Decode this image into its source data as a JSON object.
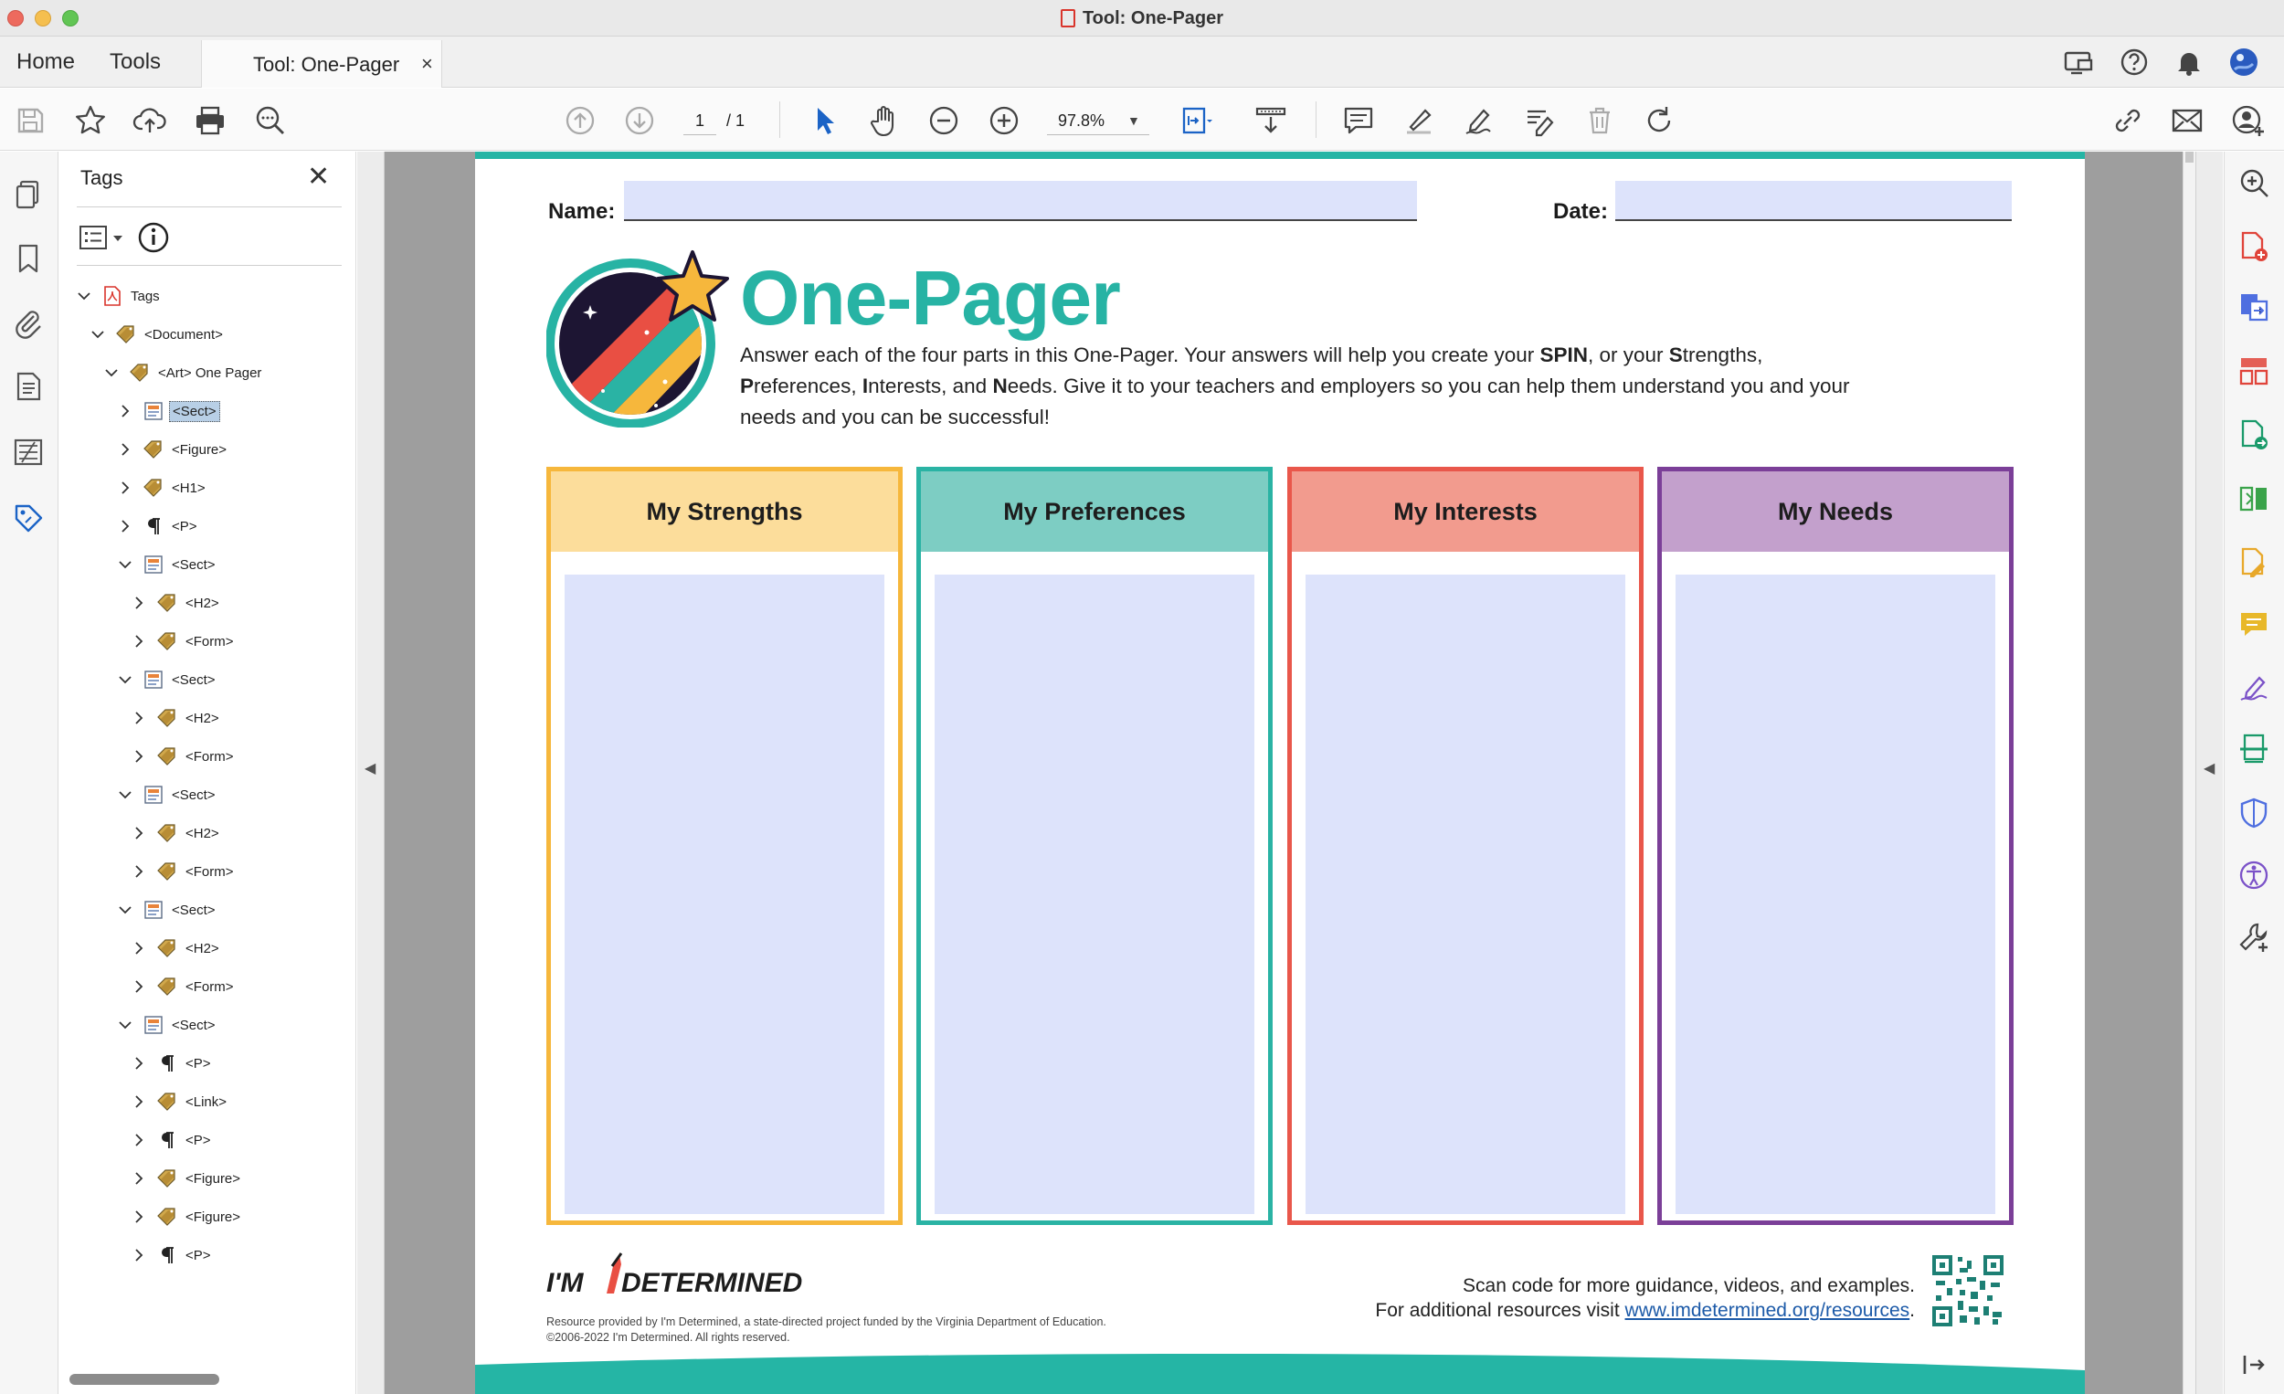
{
  "window": {
    "title": "Tool: One-Pager"
  },
  "nav": {
    "home": "Home",
    "tools": "Tools"
  },
  "tab": {
    "label": "Tool: One-Pager",
    "close": "×"
  },
  "toolbar": {
    "page_current": "1",
    "page_total": "/ 1",
    "zoom": "97.8%"
  },
  "tags_panel": {
    "title": "Tags",
    "close": "✕",
    "tree": [
      {
        "label": "Tags",
        "icon": "pdf-icon",
        "level": 0,
        "expanded": true
      },
      {
        "label": "<Document>",
        "icon": "tag-icon",
        "level": 1,
        "expanded": true
      },
      {
        "label": "<Art> One Pager",
        "icon": "tag-icon",
        "level": 2,
        "expanded": true
      },
      {
        "label": "<Sect>",
        "icon": "section-icon",
        "level": 3,
        "expanded": false,
        "selected": true
      },
      {
        "label": "<Figure>",
        "icon": "tag-icon",
        "level": 3,
        "expanded": false
      },
      {
        "label": "<H1>",
        "icon": "tag-icon",
        "level": 3,
        "expanded": false
      },
      {
        "label": "<P>",
        "icon": "paragraph-icon",
        "level": 3,
        "expanded": false
      },
      {
        "label": "<Sect>",
        "icon": "section-icon",
        "level": 3,
        "expanded": true
      },
      {
        "label": "<H2>",
        "icon": "tag-icon",
        "level": 4,
        "expanded": false
      },
      {
        "label": "<Form>",
        "icon": "tag-icon",
        "level": 4,
        "expanded": false
      },
      {
        "label": "<Sect>",
        "icon": "section-icon",
        "level": 3,
        "expanded": true
      },
      {
        "label": "<H2>",
        "icon": "tag-icon",
        "level": 4,
        "expanded": false
      },
      {
        "label": "<Form>",
        "icon": "tag-icon",
        "level": 4,
        "expanded": false
      },
      {
        "label": "<Sect>",
        "icon": "section-icon",
        "level": 3,
        "expanded": true
      },
      {
        "label": "<H2>",
        "icon": "tag-icon",
        "level": 4,
        "expanded": false
      },
      {
        "label": "<Form>",
        "icon": "tag-icon",
        "level": 4,
        "expanded": false
      },
      {
        "label": "<Sect>",
        "icon": "section-icon",
        "level": 3,
        "expanded": true
      },
      {
        "label": "<H2>",
        "icon": "tag-icon",
        "level": 4,
        "expanded": false
      },
      {
        "label": "<Form>",
        "icon": "tag-icon",
        "level": 4,
        "expanded": false
      },
      {
        "label": "<Sect>",
        "icon": "section-icon",
        "level": 3,
        "expanded": true
      },
      {
        "label": "<P>",
        "icon": "paragraph-icon",
        "level": 4,
        "expanded": false
      },
      {
        "label": "<Link>",
        "icon": "tag-icon",
        "level": 4,
        "expanded": false
      },
      {
        "label": "<P>",
        "icon": "paragraph-icon",
        "level": 4,
        "expanded": false
      },
      {
        "label": "<Figure>",
        "icon": "tag-icon",
        "level": 4,
        "expanded": false
      },
      {
        "label": "<Figure>",
        "icon": "tag-icon",
        "level": 4,
        "expanded": false
      },
      {
        "label": "<P>",
        "icon": "paragraph-icon",
        "level": 4,
        "expanded": false
      }
    ]
  },
  "document": {
    "name_label": "Name:",
    "date_label": "Date:",
    "title": "One-Pager",
    "intro": {
      "t1": "Answer each of the four parts in this One-Pager. Your answers will help you create your ",
      "b1": "SPIN",
      "t2": ", or your ",
      "b2": "S",
      "t3": "trengths, ",
      "b3": "P",
      "t4": "references, ",
      "b4": "I",
      "t5": "nterests, and ",
      "b5": "N",
      "t6": "eeds. Give it to your teachers and employers so you can help them understand you and your needs and you can be successful!"
    },
    "columns": [
      {
        "title": "My Strengths",
        "border": "#f6b73c",
        "header_bg": "#fcdd9b"
      },
      {
        "title": "My Preferences",
        "border": "#2ab3a4",
        "header_bg": "#7dcdc3"
      },
      {
        "title": "My Interests",
        "border": "#e9574b",
        "header_bg": "#f29b8e"
      },
      {
        "title": "My Needs",
        "border": "#7b3f98",
        "header_bg": "#c3a0cc"
      }
    ],
    "footer": {
      "logo_left": "I'M",
      "logo_right": "DETERMINED",
      "fine1": "Resource provided by I'm Determined, a state-directed project funded by the Virginia Department of Education.",
      "fine2": "©2006-2022 I'm Determined. All rights reserved.",
      "scan": "Scan code for more guidance, videos, and examples.",
      "resources_prefix": "For additional resources visit ",
      "resources_link": "www.imdetermined.org/resources",
      "resources_suffix": "."
    }
  },
  "colors": {
    "accent_teal": "#27b3a4",
    "field_fill": "#dde3fb",
    "selection": "#b8cfe6"
  }
}
